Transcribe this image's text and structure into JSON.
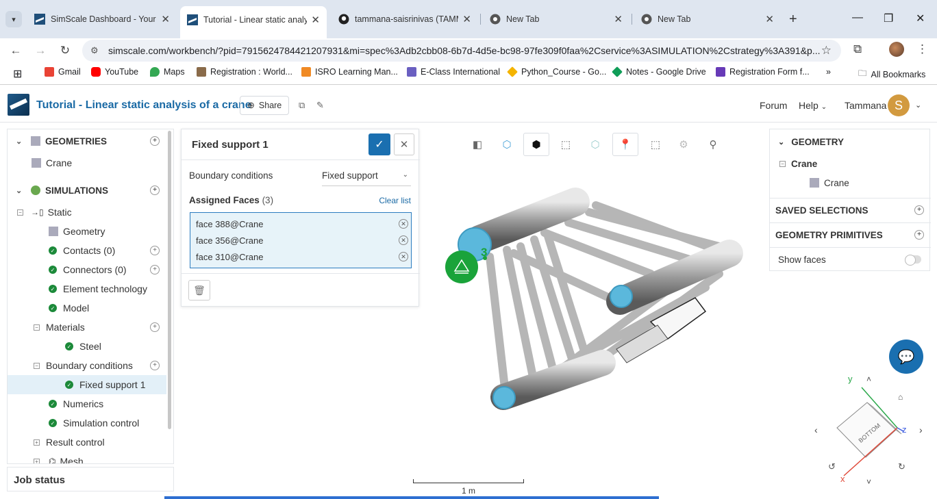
{
  "browser": {
    "tabs": [
      {
        "title": "SimScale Dashboard - Your S",
        "favicon": "simscale"
      },
      {
        "title": "Tutorial - Linear static analys",
        "favicon": "simscale"
      },
      {
        "title": "tammana-saisrinivas (TAMM",
        "favicon": "github"
      },
      {
        "title": "New Tab",
        "favicon": "chrome"
      },
      {
        "title": "New Tab",
        "favicon": "chrome"
      }
    ],
    "url": "simscale.com/workbench/?pid=7915624784421207931&mi=spec%3Adb2cbb08-6b7d-4d5e-bc98-97fe309f0faa%2Cservice%3ASIMULATION%2Cstrategy%3A391&p...",
    "bookmarks": [
      "Gmail",
      "YouTube",
      "Maps",
      "Registration : World...",
      "ISRO Learning Man...",
      "E-Class International",
      "Python_Course - Go...",
      "Notes - Google Drive",
      "Registration Form f..."
    ],
    "all_bookmarks": "All Bookmarks",
    "more_bookmarks": "»"
  },
  "header": {
    "project_title": "Tutorial - Linear static analysis of a crane",
    "share_label": "Share",
    "forum_label": "Forum",
    "help_label": "Help",
    "user_name": "Tammana",
    "user_initial": "S"
  },
  "tree": {
    "geometries_label": "GEOMETRIES",
    "geometry_crane": "Crane",
    "simulations_label": "SIMULATIONS",
    "static_label": "Static",
    "items": {
      "geometry": "Geometry",
      "contacts": "Contacts (0)",
      "connectors": "Connectors (0)",
      "element_technology": "Element technology",
      "model": "Model",
      "materials": "Materials",
      "steel": "Steel",
      "boundary_conditions": "Boundary conditions",
      "fixed_support_1": "Fixed support 1",
      "numerics": "Numerics",
      "simulation_control": "Simulation control",
      "result_control": "Result control",
      "mesh": "Mesh"
    },
    "job_status": "Job status"
  },
  "dialog": {
    "title": "Fixed support 1",
    "bc_label": "Boundary conditions",
    "bc_value": "Fixed support",
    "assigned_faces_label": "Assigned Faces",
    "assigned_faces_count": "(3)",
    "clear_list": "Clear list",
    "faces": [
      "face 388@Crane",
      "face 356@Crane",
      "face 310@Crane"
    ]
  },
  "viewer": {
    "support_marker_count": "3",
    "scale_label": "1 m",
    "cube_face_label": "BOTTOM",
    "axis_labels": {
      "x": "x",
      "y": "y",
      "z": "z"
    }
  },
  "right_panel": {
    "geometry_label": "GEOMETRY",
    "crane_group": "Crane",
    "crane_item": "Crane",
    "saved_selections": "SAVED SELECTIONS",
    "geometry_primitives": "GEOMETRY PRIMITIVES",
    "show_faces": "Show faces"
  },
  "colors": {
    "accent": "#1a6fb0",
    "title_blue": "#1a6aa5",
    "success_green": "#1c8a3a",
    "selection_blue": "#5bb8dc"
  }
}
